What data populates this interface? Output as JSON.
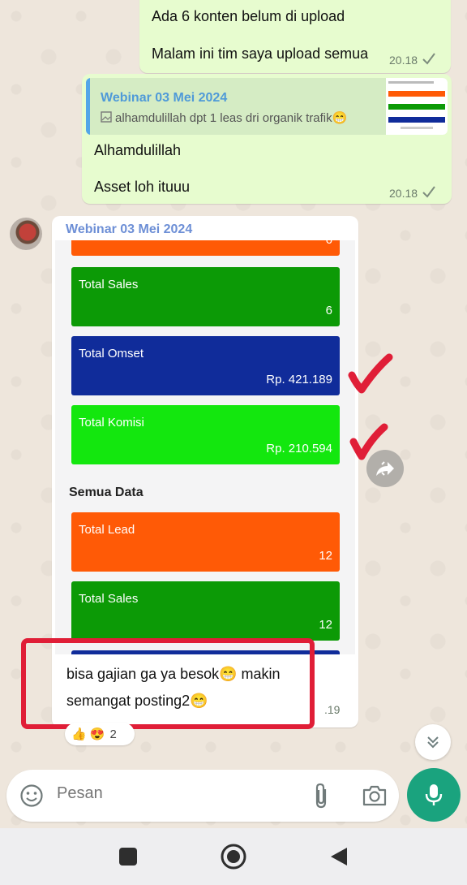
{
  "chat": {
    "msg1": {
      "line1": "Ada 6 konten belum di upload",
      "line2": "Malam ini tim saya upload semua",
      "time": "20.18"
    },
    "msg2": {
      "quote_title": "Webinar 03 Mei 2024",
      "quote_text": "alhamdulillah dpt 1 leas dri organik trafik😁",
      "line1": "Alhamdulillah",
      "line2": "Asset loh ituuu",
      "time": "20.18"
    },
    "msg3": {
      "sender": "Webinar 03 Mei 2024",
      "partial_value": "6",
      "cards_top": [
        {
          "title": "Total Sales",
          "value": "6",
          "color": "#0c9a06"
        },
        {
          "title": "Total Omset",
          "value": "Rp. 421.189",
          "color": "#102c9a"
        },
        {
          "title": "Total Komisi",
          "value": "Rp. 210.594",
          "color": "#13e70e"
        }
      ],
      "section_title": "Semua Data",
      "cards_bottom": [
        {
          "title": "Total Lead",
          "value": "12",
          "color": "#ff5a06"
        },
        {
          "title": "Total Sales",
          "value": "12",
          "color": "#0c9a06"
        }
      ],
      "caption_line1": "bisa gajian ga ya besok😁 makin",
      "caption_line2": "semangat posting2😁",
      "time": ".19"
    },
    "reactions": {
      "emojis": "👍 😍",
      "count": "2"
    }
  },
  "input": {
    "placeholder": "Pesan"
  },
  "colors": {
    "outgoing_bubble": "#e7fccf",
    "accent_green": "#1aa37e",
    "annotation_red": "#e01e37"
  },
  "icons": [
    "forward-icon",
    "emoji-icon",
    "attach-icon",
    "camera-icon",
    "mic-icon",
    "chevron-double-down-icon",
    "square-nav-icon",
    "circle-nav-icon",
    "back-nav-icon"
  ]
}
